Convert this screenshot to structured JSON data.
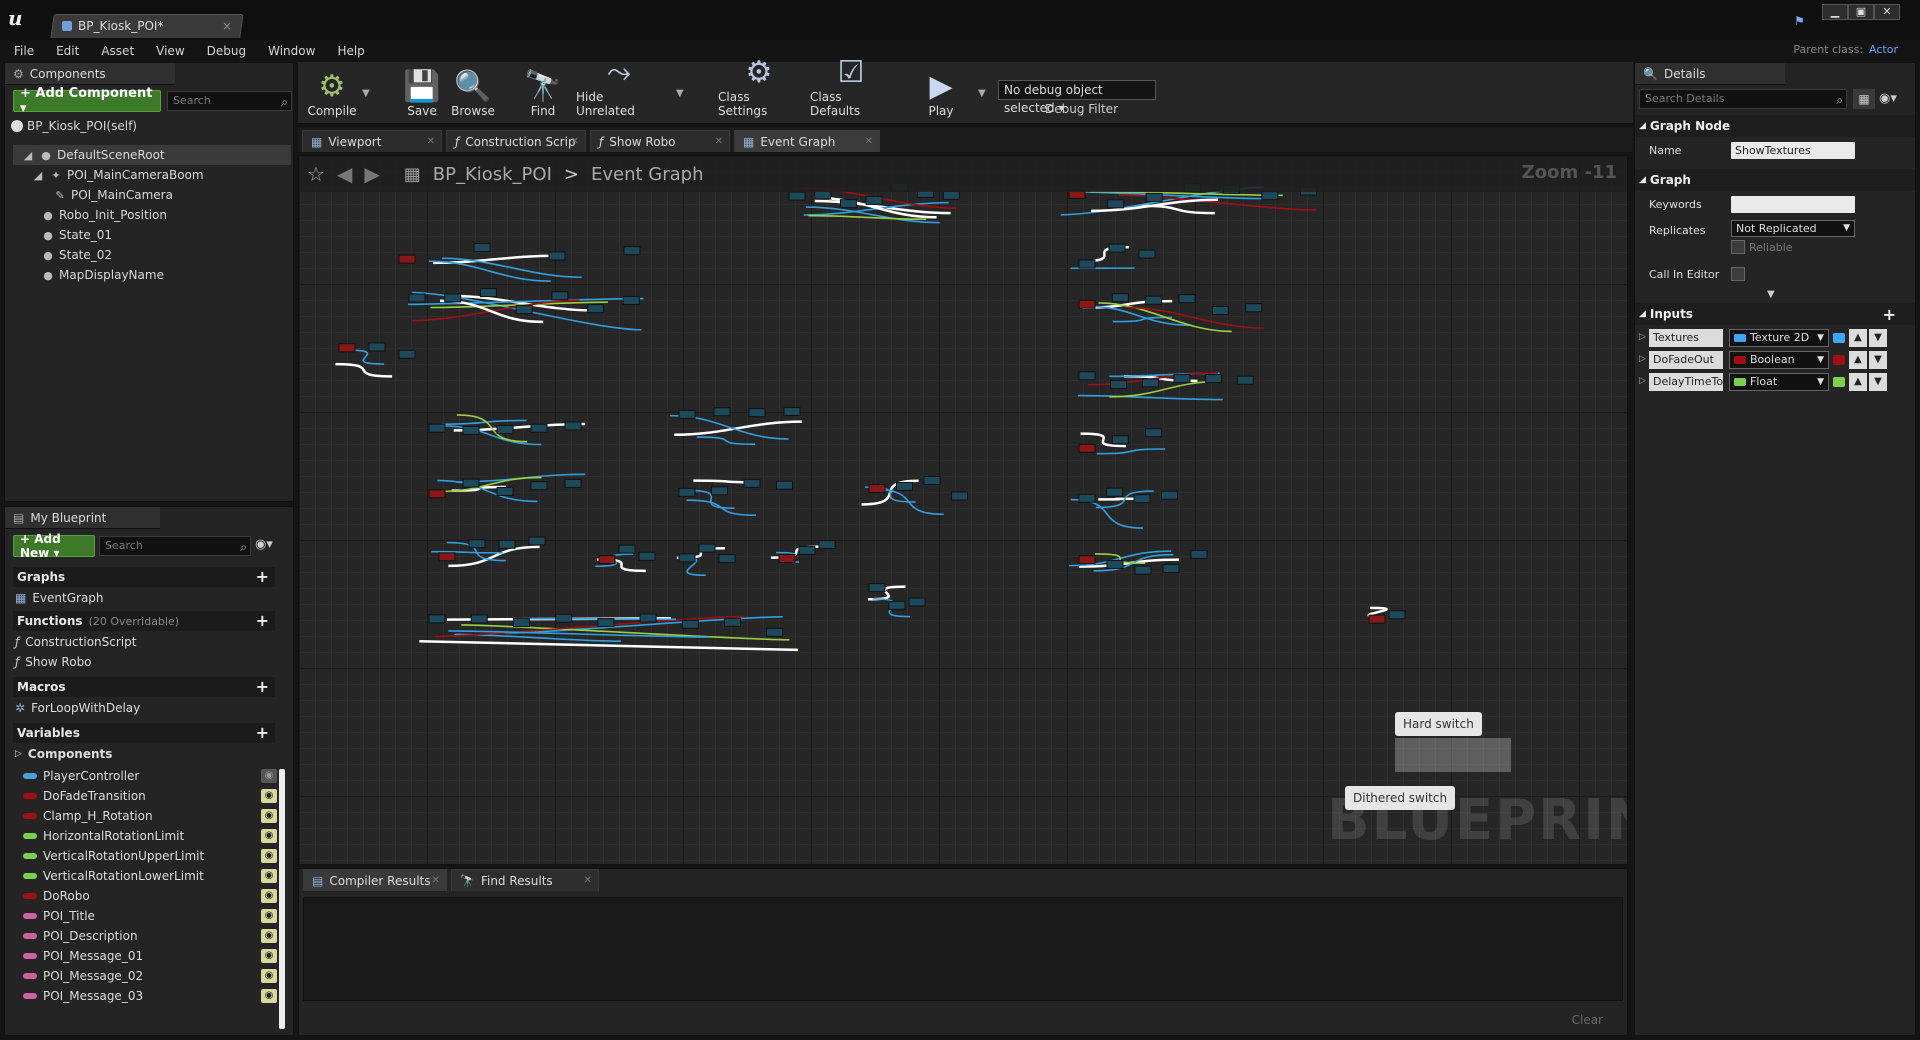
{
  "window": {
    "tab_title": "BP_Kiosk_POI*",
    "tab_close": "×",
    "min": "▁",
    "max": "▣",
    "close": "✕",
    "logo": "u"
  },
  "menu": [
    "File",
    "Edit",
    "Asset",
    "View",
    "Debug",
    "Window",
    "Help"
  ],
  "parent_class": {
    "label": "Parent class:",
    "value": "Actor"
  },
  "components_panel": {
    "tab": "Components",
    "add_button": "+ Add Component ▾",
    "search_placeholder": "Search",
    "self_item": "BP_Kiosk_POI(self)",
    "tree": [
      {
        "label": "DefaultSceneRoot",
        "indent": 0
      },
      {
        "label": "POI_MainCameraBoom",
        "indent": 1
      },
      {
        "label": "POI_MainCamera",
        "indent": 2
      },
      {
        "label": "Robo_Init_Position",
        "indent": 1
      },
      {
        "label": "State_01",
        "indent": 1
      },
      {
        "label": "State_02",
        "indent": 1
      },
      {
        "label": "MapDisplayName",
        "indent": 1
      }
    ]
  },
  "my_blueprint": {
    "tab": "My Blueprint",
    "add_new": "+ Add New ▾",
    "search_placeholder": "Search",
    "graphs_head": "Graphs",
    "graphs": [
      "EventGraph"
    ],
    "functions_head": "Functions",
    "functions_sub": "(20 Overridable)",
    "functions": [
      "ConstructionScript",
      "Show Robo"
    ],
    "macros_head": "Macros",
    "macros": [
      "ForLoopWithDelay"
    ],
    "variables_head": "Variables",
    "components_head": "Components",
    "variables": [
      {
        "name": "PlayerController",
        "color": "#3fa6d6"
      },
      {
        "name": "DoFadeTransition",
        "color": "#a01010"
      },
      {
        "name": "Clamp_H_Rotation",
        "color": "#a01010"
      },
      {
        "name": "HorizontalRotationLimit",
        "color": "#7ad14a"
      },
      {
        "name": "VerticalRotationUpperLimit",
        "color": "#7ad14a"
      },
      {
        "name": "VerticalRotationLowerLimit",
        "color": "#7ad14a"
      },
      {
        "name": "DoRobo",
        "color": "#a01010"
      },
      {
        "name": "POI_Title",
        "color": "#d060a0"
      },
      {
        "name": "POI_Description",
        "color": "#d060a0"
      },
      {
        "name": "POI_Message_01",
        "color": "#d060a0"
      },
      {
        "name": "POI_Message_02",
        "color": "#d060a0"
      },
      {
        "name": "POI_Message_03",
        "color": "#d060a0"
      }
    ]
  },
  "toolbar": {
    "buttons": [
      {
        "label": "Compile",
        "glyph": "⚙"
      },
      {
        "label": "Save",
        "glyph": "💾"
      },
      {
        "label": "Browse",
        "glyph": "🔍"
      },
      {
        "label": "Find",
        "glyph": "🔭"
      },
      {
        "label": "Hide Unrelated",
        "glyph": "⤳"
      },
      {
        "label": "Class Settings",
        "glyph": "⚙"
      },
      {
        "label": "Class Defaults",
        "glyph": "☑"
      },
      {
        "label": "Play",
        "glyph": "▶"
      }
    ],
    "debug_select": "No debug object selected ▾",
    "debug_label": "Debug Filter"
  },
  "graph_tabs": [
    "Viewport",
    "Construction Scrip",
    "Show Robo",
    "Event Graph"
  ],
  "graph": {
    "breadcrumb_root": "BP_Kiosk_POI",
    "breadcrumb_sep": ">",
    "breadcrumb_current": "Event Graph",
    "zoom": "Zoom -11",
    "watermark": "BLUEPRINT",
    "comment_hard": "Hard switch",
    "comment_dithered": "Dithered switch"
  },
  "results": {
    "tabs": [
      "Compiler Results",
      "Find Results"
    ],
    "clear": "Clear"
  },
  "details": {
    "tab": "Details",
    "search_placeholder": "Search Details",
    "graph_node_head": "Graph Node",
    "name_label": "Name",
    "name_value": "ShowTextures",
    "graph_head": "Graph",
    "keywords_label": "Keywords",
    "replicates_label": "Replicates",
    "replicates_value": "Not Replicated",
    "reliable_label": "Reliable",
    "call_in_editor_label": "Call In Editor",
    "inputs_head": "Inputs",
    "inputs": [
      {
        "name": "Textures",
        "type": "Texture 2D",
        "color": "#3fa6ff"
      },
      {
        "name": "DoFadeOut",
        "type": "Boolean",
        "color": "#a01010"
      },
      {
        "name": "DelayTimeTo",
        "type": "Float",
        "color": "#7ad14a"
      }
    ]
  },
  "colors": {
    "accent_blue": "#5aa6ff",
    "add_green": "#3d7a27",
    "wire_exec": "#ffffff",
    "wire_object": "#2fa0e0",
    "wire_bool": "#a01010",
    "wire_float": "#9ad040"
  }
}
